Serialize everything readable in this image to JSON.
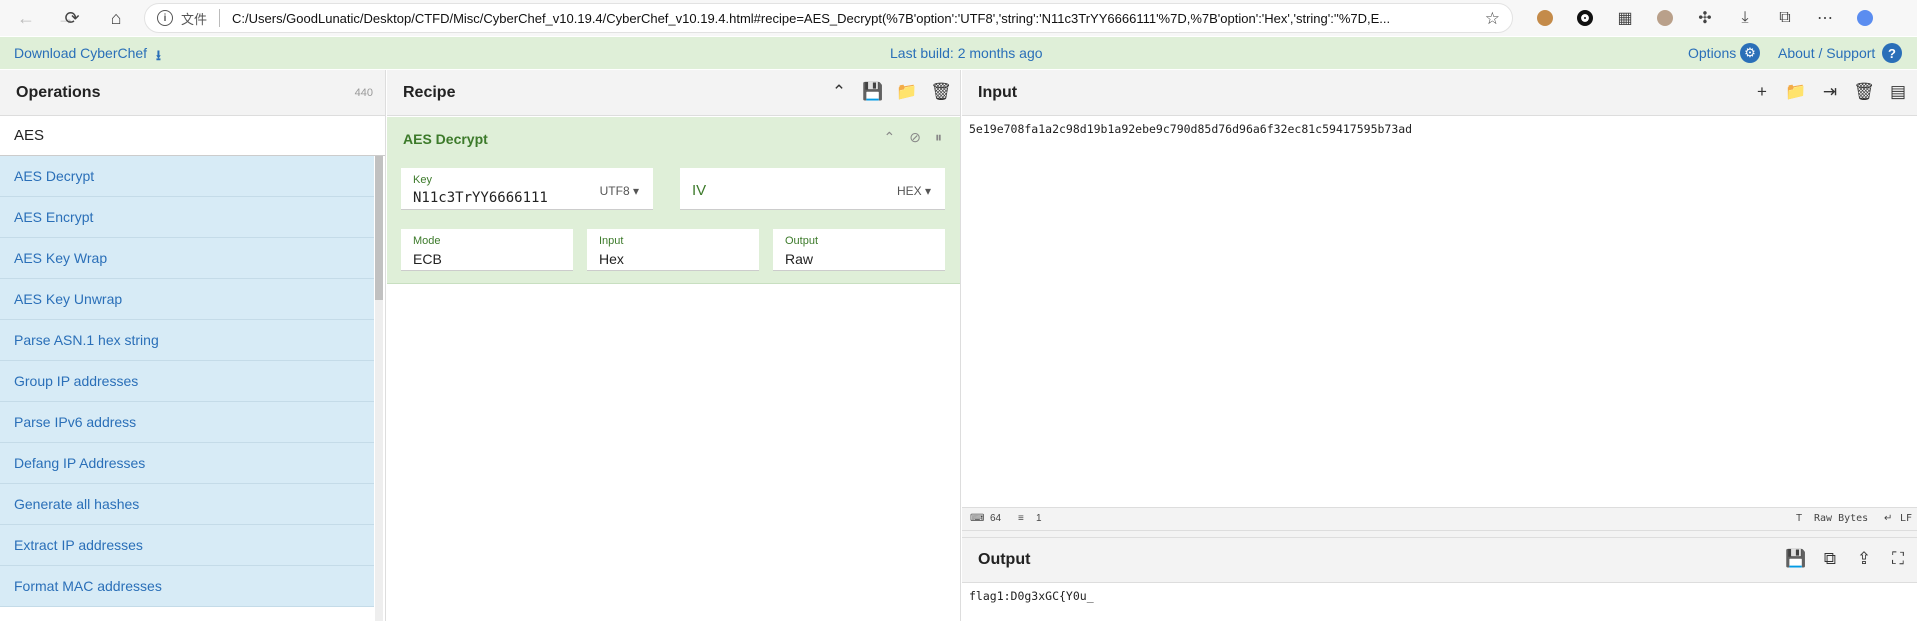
{
  "browser": {
    "scheme_label": "文件",
    "url": "C:/Users/GoodLunatic/Desktop/CTFD/Misc/CyberChef_v10.19.4/CyberChef_v10.19.4.html#recipe=AES_Decrypt(%7B'option':'UTF8','string':'N11c3TrYY6666111'%7D,%7B'option':'Hex','string':''%7D,E..."
  },
  "banner": {
    "download_label": "Download CyberChef",
    "build_label": "Last build: 2 months ago",
    "options_label": "Options",
    "about_label": "About / Support"
  },
  "operations": {
    "title": "Operations",
    "count": "440",
    "search_value": "AES",
    "items": [
      {
        "label": "AES Decrypt"
      },
      {
        "label": "AES Encrypt"
      },
      {
        "label": "AES Key Wrap"
      },
      {
        "label": "AES Key Unwrap"
      },
      {
        "label": "Parse ASN.1 hex string"
      },
      {
        "label": "Group IP addresses"
      },
      {
        "label": "Parse IPv6 address"
      },
      {
        "label": "Defang IP Addresses"
      },
      {
        "label": "Generate all hashes"
      },
      {
        "label": "Extract IP addresses"
      },
      {
        "label": "Format MAC addresses"
      }
    ]
  },
  "recipe": {
    "title": "Recipe",
    "operation": {
      "name": "AES Decrypt",
      "key_label": "Key",
      "key_value": "N11c3TrYY6666111",
      "key_format": "UTF8",
      "iv_label": "IV",
      "iv_format": "HEX",
      "mode_label": "Mode",
      "mode_value": "ECB",
      "input_label": "Input",
      "input_value": "Hex",
      "output_label": "Output",
      "output_value": "Raw"
    }
  },
  "input": {
    "title": "Input",
    "text": "5e19e708fa1a2c98d19b1a92ebe9c790d85d76d96a6f32ec81c59417595b73ad",
    "char_count": "64",
    "line_count": "1",
    "encoding": "Raw Bytes",
    "eol": "LF"
  },
  "output": {
    "title": "Output",
    "text": "flag1:D0g3xGC{Y0u_"
  }
}
